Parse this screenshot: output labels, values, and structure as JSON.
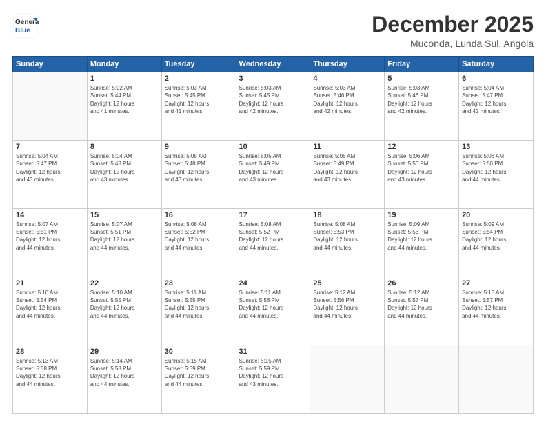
{
  "header": {
    "logo_general": "General",
    "logo_blue": "Blue",
    "month_title": "December 2025",
    "subtitle": "Muconda, Lunda Sul, Angola"
  },
  "days_of_week": [
    "Sunday",
    "Monday",
    "Tuesday",
    "Wednesday",
    "Thursday",
    "Friday",
    "Saturday"
  ],
  "weeks": [
    [
      {
        "day": "",
        "info": ""
      },
      {
        "day": "1",
        "info": "Sunrise: 5:02 AM\nSunset: 5:44 PM\nDaylight: 12 hours\nand 41 minutes."
      },
      {
        "day": "2",
        "info": "Sunrise: 5:03 AM\nSunset: 5:45 PM\nDaylight: 12 hours\nand 41 minutes."
      },
      {
        "day": "3",
        "info": "Sunrise: 5:03 AM\nSunset: 5:45 PM\nDaylight: 12 hours\nand 42 minutes."
      },
      {
        "day": "4",
        "info": "Sunrise: 5:03 AM\nSunset: 5:46 PM\nDaylight: 12 hours\nand 42 minutes."
      },
      {
        "day": "5",
        "info": "Sunrise: 5:03 AM\nSunset: 5:46 PM\nDaylight: 12 hours\nand 42 minutes."
      },
      {
        "day": "6",
        "info": "Sunrise: 5:04 AM\nSunset: 5:47 PM\nDaylight: 12 hours\nand 42 minutes."
      }
    ],
    [
      {
        "day": "7",
        "info": "Sunrise: 5:04 AM\nSunset: 5:47 PM\nDaylight: 12 hours\nand 43 minutes."
      },
      {
        "day": "8",
        "info": "Sunrise: 5:04 AM\nSunset: 5:48 PM\nDaylight: 12 hours\nand 43 minutes."
      },
      {
        "day": "9",
        "info": "Sunrise: 5:05 AM\nSunset: 5:48 PM\nDaylight: 12 hours\nand 43 minutes."
      },
      {
        "day": "10",
        "info": "Sunrise: 5:05 AM\nSunset: 5:49 PM\nDaylight: 12 hours\nand 43 minutes."
      },
      {
        "day": "11",
        "info": "Sunrise: 5:05 AM\nSunset: 5:49 PM\nDaylight: 12 hours\nand 43 minutes."
      },
      {
        "day": "12",
        "info": "Sunrise: 5:06 AM\nSunset: 5:50 PM\nDaylight: 12 hours\nand 43 minutes."
      },
      {
        "day": "13",
        "info": "Sunrise: 5:06 AM\nSunset: 5:50 PM\nDaylight: 12 hours\nand 44 minutes."
      }
    ],
    [
      {
        "day": "14",
        "info": "Sunrise: 5:07 AM\nSunset: 5:51 PM\nDaylight: 12 hours\nand 44 minutes."
      },
      {
        "day": "15",
        "info": "Sunrise: 5:07 AM\nSunset: 5:51 PM\nDaylight: 12 hours\nand 44 minutes."
      },
      {
        "day": "16",
        "info": "Sunrise: 5:08 AM\nSunset: 5:52 PM\nDaylight: 12 hours\nand 44 minutes."
      },
      {
        "day": "17",
        "info": "Sunrise: 5:08 AM\nSunset: 5:52 PM\nDaylight: 12 hours\nand 44 minutes."
      },
      {
        "day": "18",
        "info": "Sunrise: 5:08 AM\nSunset: 5:53 PM\nDaylight: 12 hours\nand 44 minutes."
      },
      {
        "day": "19",
        "info": "Sunrise: 5:09 AM\nSunset: 5:53 PM\nDaylight: 12 hours\nand 44 minutes."
      },
      {
        "day": "20",
        "info": "Sunrise: 5:09 AM\nSunset: 5:54 PM\nDaylight: 12 hours\nand 44 minutes."
      }
    ],
    [
      {
        "day": "21",
        "info": "Sunrise: 5:10 AM\nSunset: 5:54 PM\nDaylight: 12 hours\nand 44 minutes."
      },
      {
        "day": "22",
        "info": "Sunrise: 5:10 AM\nSunset: 5:55 PM\nDaylight: 12 hours\nand 44 minutes."
      },
      {
        "day": "23",
        "info": "Sunrise: 5:11 AM\nSunset: 5:55 PM\nDaylight: 12 hours\nand 44 minutes."
      },
      {
        "day": "24",
        "info": "Sunrise: 5:11 AM\nSunset: 5:56 PM\nDaylight: 12 hours\nand 44 minutes."
      },
      {
        "day": "25",
        "info": "Sunrise: 5:12 AM\nSunset: 5:56 PM\nDaylight: 12 hours\nand 44 minutes."
      },
      {
        "day": "26",
        "info": "Sunrise: 5:12 AM\nSunset: 5:57 PM\nDaylight: 12 hours\nand 44 minutes."
      },
      {
        "day": "27",
        "info": "Sunrise: 5:13 AM\nSunset: 5:57 PM\nDaylight: 12 hours\nand 44 minutes."
      }
    ],
    [
      {
        "day": "28",
        "info": "Sunrise: 5:13 AM\nSunset: 5:58 PM\nDaylight: 12 hours\nand 44 minutes."
      },
      {
        "day": "29",
        "info": "Sunrise: 5:14 AM\nSunset: 5:58 PM\nDaylight: 12 hours\nand 44 minutes."
      },
      {
        "day": "30",
        "info": "Sunrise: 5:15 AM\nSunset: 5:59 PM\nDaylight: 12 hours\nand 44 minutes."
      },
      {
        "day": "31",
        "info": "Sunrise: 5:15 AM\nSunset: 5:59 PM\nDaylight: 12 hours\nand 43 minutes."
      },
      {
        "day": "",
        "info": ""
      },
      {
        "day": "",
        "info": ""
      },
      {
        "day": "",
        "info": ""
      }
    ]
  ]
}
